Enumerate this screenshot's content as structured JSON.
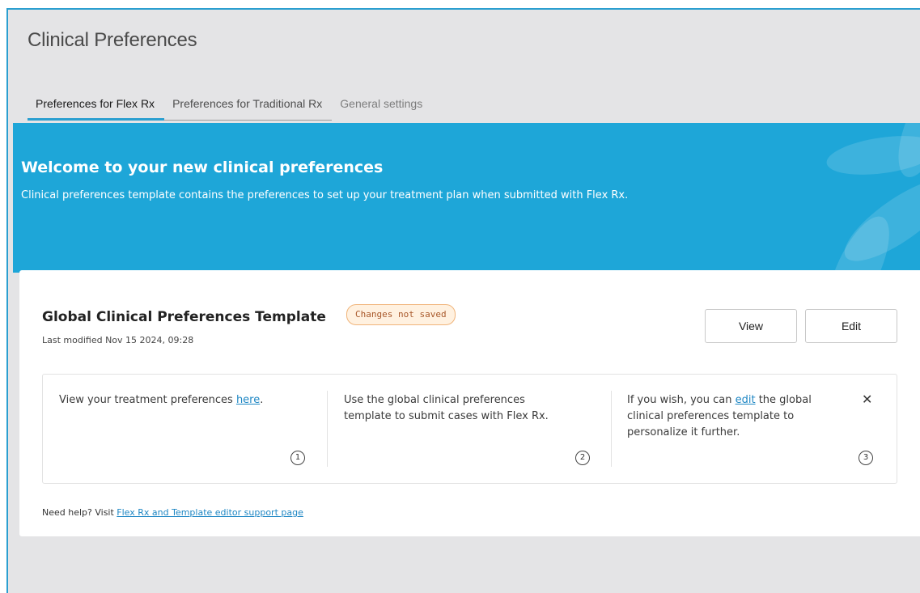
{
  "page": {
    "title": "Clinical Preferences"
  },
  "tabs": [
    {
      "label": "Preferences for Flex Rx",
      "active": true
    },
    {
      "label": "Preferences for Traditional Rx",
      "active": false
    },
    {
      "label": "General settings",
      "active": false
    }
  ],
  "banner": {
    "heading": "Welcome to your new clinical preferences",
    "description": "Clinical preferences template contains the preferences to set up your treatment plan when submitted with Flex Rx.",
    "background_color": "#1ea6d8"
  },
  "template_card": {
    "title": "Global Clinical Preferences Template",
    "badge": "Changes not saved",
    "last_modified": "Last modified Nov 15 2024, 09:28",
    "view_label": "View",
    "edit_label": "Edit"
  },
  "steps": [
    {
      "text_before": "View your treatment preferences ",
      "link": "here",
      "text_after": ".",
      "number": "1"
    },
    {
      "text_before": "Use the global clinical preferences template to submit cases with Flex Rx.",
      "link": "",
      "text_after": "",
      "number": "2"
    },
    {
      "text_before": "If you wish, you can ",
      "link": "edit",
      "text_after": " the global clinical preferences template to personalize it further.",
      "number": "3"
    }
  ],
  "steps_close_icon": "close-icon",
  "help": {
    "prefix": "Need help? Visit ",
    "link": "Flex Rx and Template editor support page"
  },
  "colors": {
    "accent": "#2b9fd0",
    "link": "#1f87c4",
    "badge_border": "#f0b47a"
  }
}
